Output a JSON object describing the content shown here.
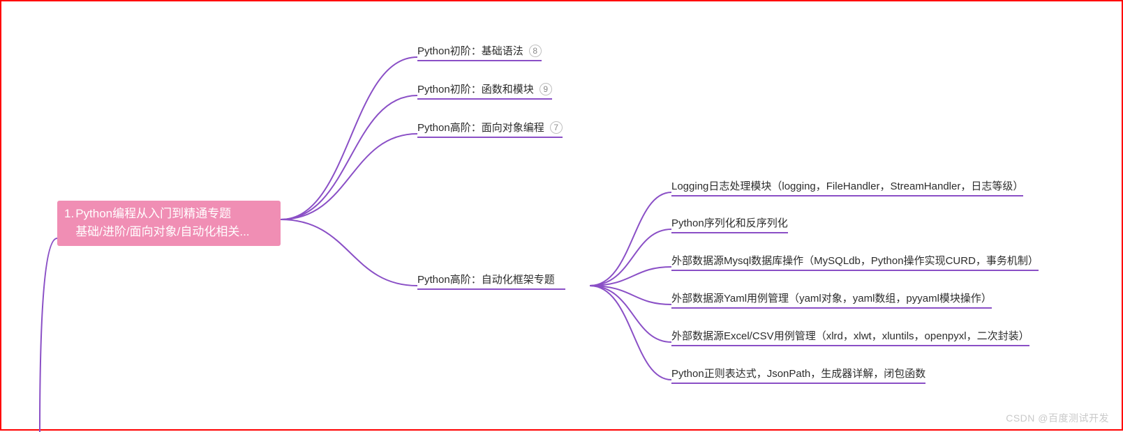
{
  "root": {
    "number": "1.",
    "title_line1": "Python编程从入门到精通专题",
    "title_line2": "基础/进阶/面向对象/自动化相关..."
  },
  "colors": {
    "root_bg": "#f08eb4",
    "branch": "#8a4fc6",
    "frame": "#ff0000"
  },
  "branches": [
    {
      "label": "Python初阶：基础语法",
      "badge": "8"
    },
    {
      "label": "Python初阶：函数和模块",
      "badge": "9"
    },
    {
      "label": "Python高阶：面向对象编程",
      "badge": "7"
    },
    {
      "label": "Python高阶：自动化框架专题",
      "badge": ""
    }
  ],
  "subBranches": [
    {
      "label": "Logging日志处理模块（logging，FileHandler，StreamHandler，日志等级）"
    },
    {
      "label": "Python序列化和反序列化"
    },
    {
      "label": "外部数据源Mysql数据库操作（MySQLdb，Python操作实现CURD，事务机制）"
    },
    {
      "label": "外部数据源Yaml用例管理（yaml对象，yaml数组，pyyaml模块操作）"
    },
    {
      "label": "外部数据源Excel/CSV用例管理（xlrd，xlwt，xluntils，openpyxl，二次封装）"
    },
    {
      "label": "Python正则表达式，JsonPath，生成器详解，闭包函数"
    }
  ],
  "watermark": "CSDN @百度测试开发"
}
